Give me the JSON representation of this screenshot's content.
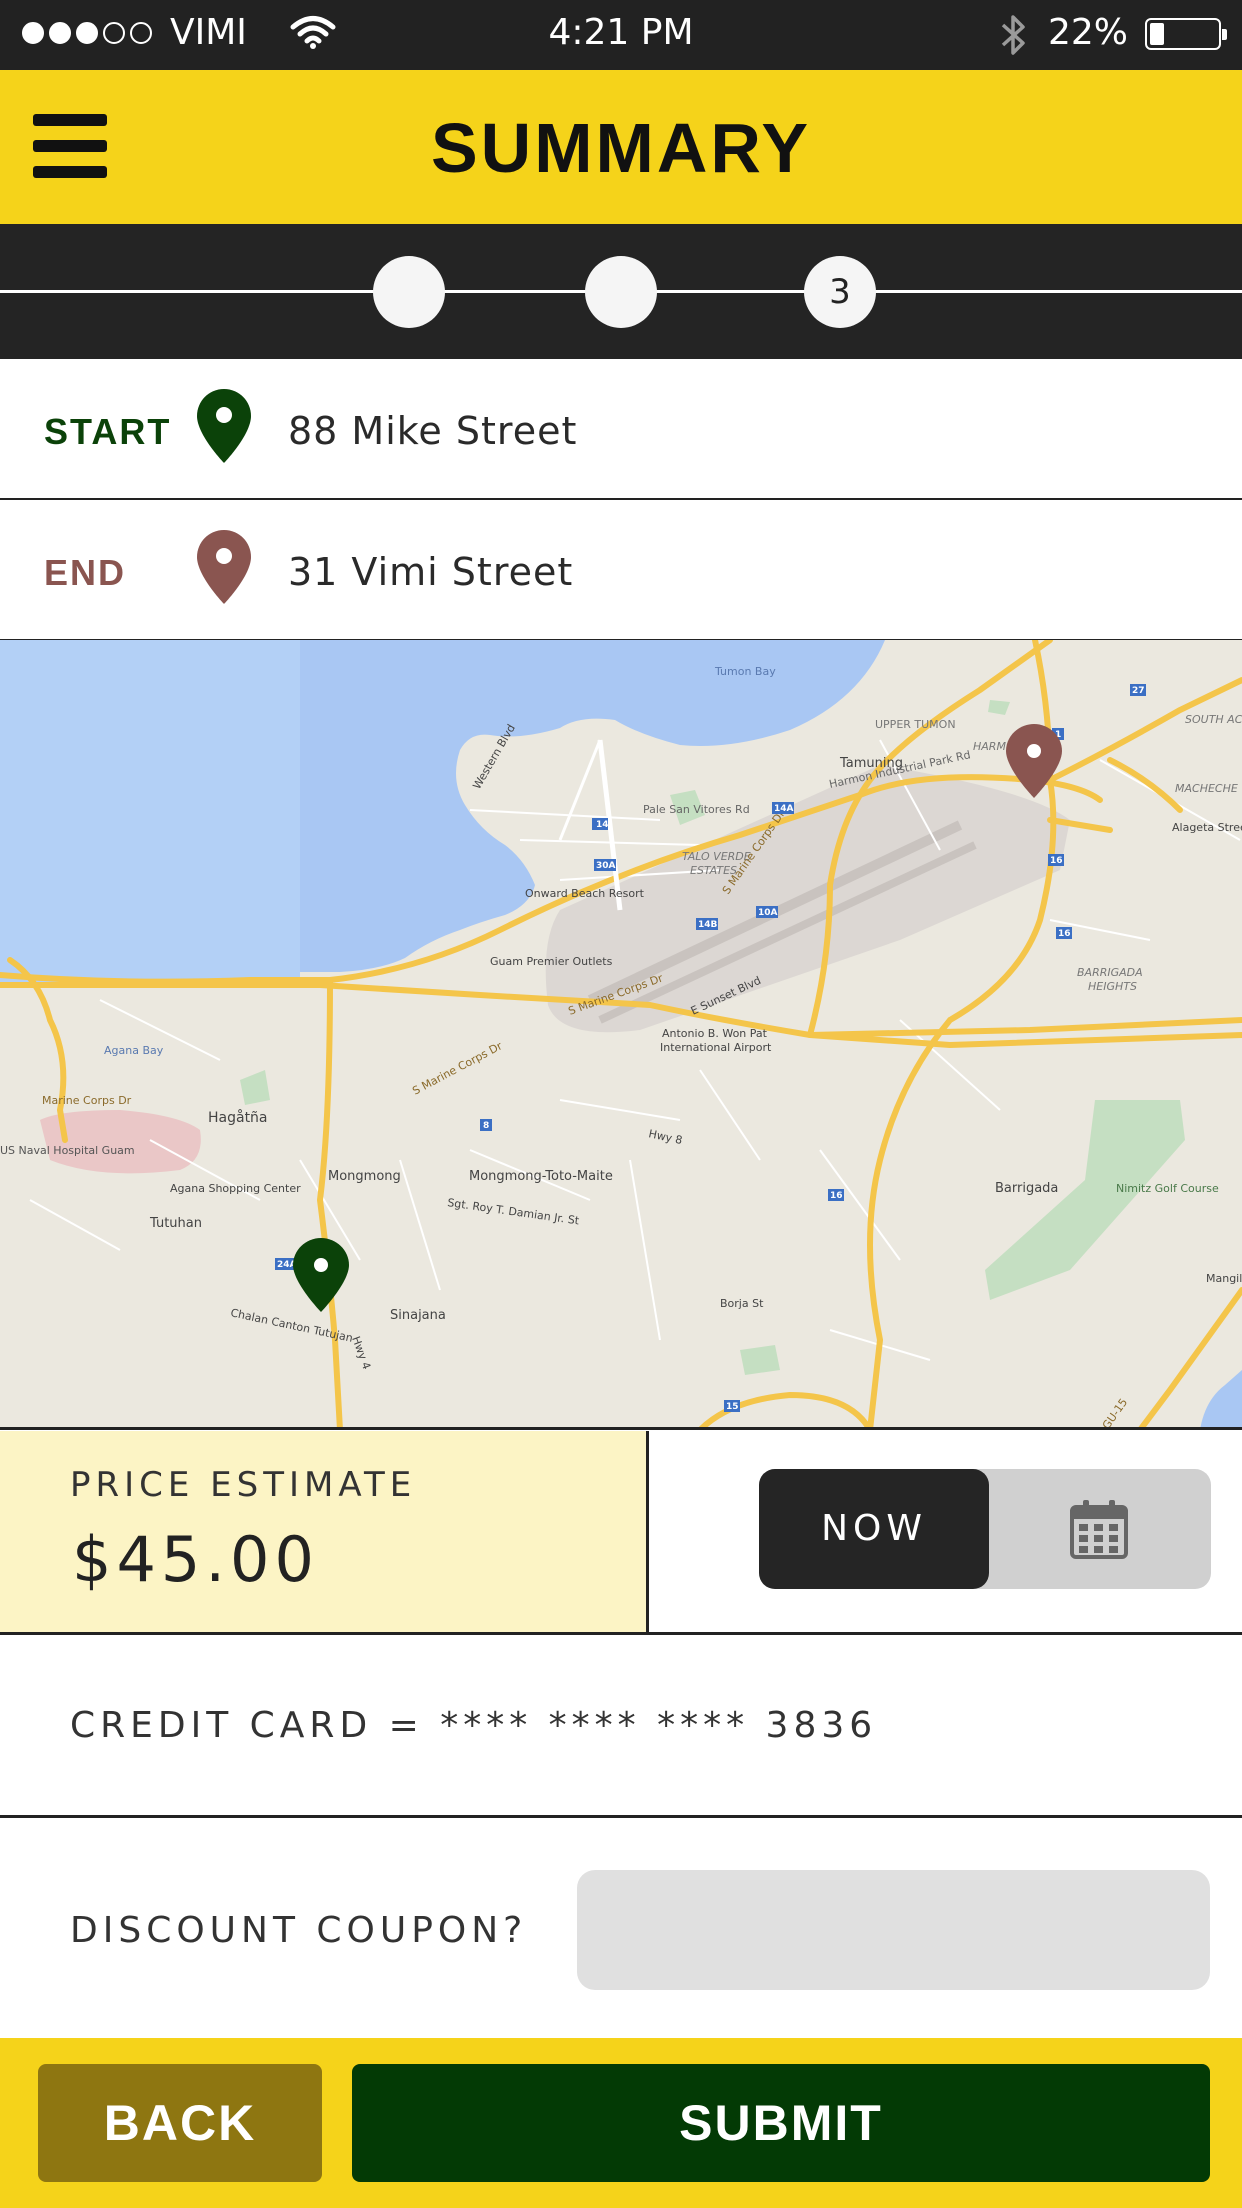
{
  "status_bar": {
    "carrier": "VIMI",
    "time": "4:21 PM",
    "battery": "22%",
    "signal_strength": 3,
    "signal_max": 5,
    "battery_level": 0.22
  },
  "header": {
    "title": "SUMMARY",
    "menu_icon": "hamburger-menu-icon"
  },
  "stepper": {
    "steps": [
      "",
      "",
      "3"
    ],
    "current_step": 3
  },
  "route": {
    "start_label": "START",
    "start_address": "88 Mike Street",
    "start_color": "#0b4209",
    "end_label": "END",
    "end_address": "31 Vimi Street",
    "end_color": "#8a5550"
  },
  "map": {
    "labels": [
      {
        "key": "tumon_bay",
        "text": "Tumon Bay"
      },
      {
        "key": "upper_tumon",
        "text": "UPPER TUMON"
      },
      {
        "key": "tamuning",
        "text": "Tamuning"
      },
      {
        "key": "harmon_industrial",
        "text": "Harmon Industrial Park Rd"
      },
      {
        "key": "pale_san_vitores",
        "text": "Pale San Vitores Rd"
      },
      {
        "key": "talo_verde",
        "text": "TALO VERDE"
      },
      {
        "key": "estates",
        "text": "ESTATES"
      },
      {
        "key": "onward_beach",
        "text": "Onward Beach Resort"
      },
      {
        "key": "guam_premier",
        "text": "Guam Premier Outlets"
      },
      {
        "key": "marine_corps_dr_a",
        "text": "S Marine Corps Dr"
      },
      {
        "key": "marine_corps_dr_b",
        "text": "S Marine Corps Dr"
      },
      {
        "key": "marine_corps_dr_c",
        "text": "S Marine Corps Dr"
      },
      {
        "key": "agana_bay",
        "text": "Agana Bay"
      },
      {
        "key": "marine_corps_dr_w",
        "text": "Marine Corps Dr"
      },
      {
        "key": "hagatna",
        "text": "Hagåtña"
      },
      {
        "key": "naval_hospital",
        "text": "US Naval Hospital Guam"
      },
      {
        "key": "mongmong",
        "text": "Mongmong"
      },
      {
        "key": "mongmong_toto_maite",
        "text": "Mongmong-Toto-Maite"
      },
      {
        "key": "agana_shopping",
        "text": "Agana Shopping Center"
      },
      {
        "key": "tutuhan",
        "text": "Tutuhan"
      },
      {
        "key": "sinajana",
        "text": "Sinajana"
      },
      {
        "key": "airport_1",
        "text": "Antonio B. Won Pat"
      },
      {
        "key": "airport_2",
        "text": "International Airport"
      },
      {
        "key": "barrigada",
        "text": "Barrigada"
      },
      {
        "key": "barrigada_heights_1",
        "text": "BARRIGADA"
      },
      {
        "key": "barrigada_heights_2",
        "text": "HEIGHTS"
      },
      {
        "key": "nimitz_golf",
        "text": "Nimitz Golf Course"
      },
      {
        "key": "machecha",
        "text": "MACHECHE"
      },
      {
        "key": "south_acres",
        "text": "SOUTH AC"
      },
      {
        "key": "alageta_st",
        "text": "Alageta Street"
      },
      {
        "key": "hwy8",
        "text": "Hwy 8"
      },
      {
        "key": "sgt_roy",
        "text": "Sgt. Roy T. Damian Jr. St"
      },
      {
        "key": "borja_st",
        "text": "Borja St"
      },
      {
        "key": "chalan_canton",
        "text": "Chalan Canton Tutujan"
      },
      {
        "key": "hwy4",
        "text": "Hwy 4"
      },
      {
        "key": "sunset_blvd",
        "text": "E Sunset Blvd"
      },
      {
        "key": "western_blvd",
        "text": "Western Blvd"
      },
      {
        "key": "harmon",
        "text": "HARM"
      },
      {
        "key": "mangil",
        "text": "Mangil"
      },
      {
        "key": "gu15",
        "text": "GU-15"
      }
    ],
    "shields": [
      "14",
      "14A",
      "14B",
      "10A",
      "30A",
      "27",
      "16",
      "16",
      "16",
      "15",
      "8",
      "24A",
      "1"
    ],
    "start_pin_color": "#0b4209",
    "end_pin_color": "#8a5550"
  },
  "pricing": {
    "label": "PRICE ESTIMATE",
    "value": "$45.00"
  },
  "timing": {
    "now_label": "NOW",
    "calendar_icon": "calendar-icon",
    "selected": "NOW"
  },
  "payment": {
    "card_text": "CREDIT CARD = **** **** **** 3836"
  },
  "coupon": {
    "label": "DISCOUNT COUPON?",
    "value": "",
    "placeholder": ""
  },
  "footer": {
    "back_label": "BACK",
    "submit_label": "SUBMIT"
  },
  "colors": {
    "accent_yellow": "#f5d31a",
    "dark": "#242424",
    "back_button": "#8e7611",
    "submit_button": "#033a05",
    "price_bg": "#fcf4c5"
  }
}
